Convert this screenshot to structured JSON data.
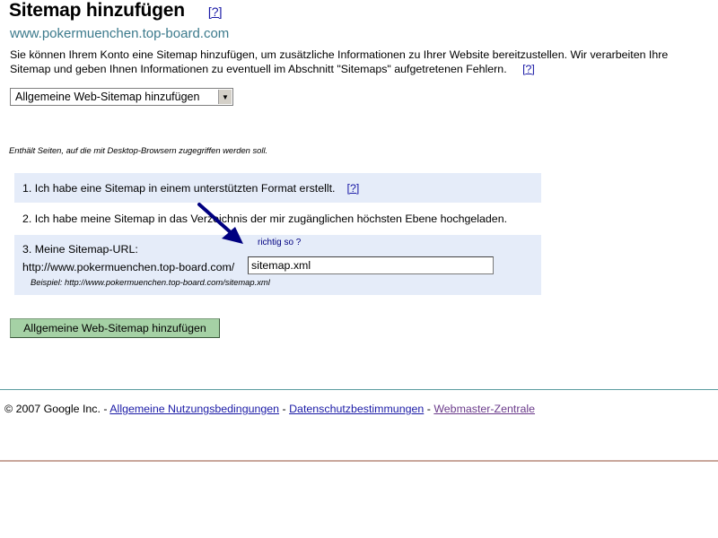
{
  "header": {
    "title": "Sitemap hinzufügen",
    "help_label": "[?]",
    "site_url": "www.pokermuenchen.top-board.com"
  },
  "intro": {
    "text": "Sie können Ihrem Konto eine Sitemap hinzufügen, um zusätzliche Informationen zu Ihrer Website bereitzustellen. Wir verarbeiten Ihre Sitemap und geben Ihnen Informationen zu eventuell im Abschnitt \"Sitemaps\" aufgetretenen Fehlern.",
    "help_label": "[?]"
  },
  "sitemap_type": {
    "selected": "Allgemeine Web-Sitemap hinzufügen",
    "dropdown_icon": "triangle-down-icon",
    "description": "Enthält Seiten, auf die mit Desktop-Browsern zugegriffen werden soll."
  },
  "steps": {
    "step1": "1. Ich habe eine Sitemap in einem unterstützten Format erstellt.",
    "step1_help": "[?]",
    "step2": "2. Ich habe meine Sitemap in das Verzeichnis der mir zugänglichen höchsten Ebene hochgeladen.",
    "step3_label": "3. Meine Sitemap-URL:",
    "url_prefix": "http://www.pokermuenchen.top-board.com/",
    "url_value": "sitemap.xml",
    "example": "Beispiel: http://www.pokermuenchen.top-board.com/sitemap.xml"
  },
  "annotation": {
    "text": "richtig so ?",
    "color": "#000080"
  },
  "submit_label": "Allgemeine Web-Sitemap hinzufügen",
  "footer": {
    "copyright": "© 2007 Google Inc. -",
    "separator": "-",
    "links": [
      "Allgemeine Nutzungsbedingungen",
      "Datenschutzbestimmungen",
      "Webmaster-Zentrale"
    ]
  },
  "colors": {
    "link": "#1a1aa6",
    "visited_link": "#6a3a8a",
    "site_url": "#3c7a8c",
    "step_bg": "#e5ecf9",
    "button_bg": "#a5d1a5",
    "divider_top": "#5c9ca0",
    "divider_bottom": "#c9a79b"
  }
}
